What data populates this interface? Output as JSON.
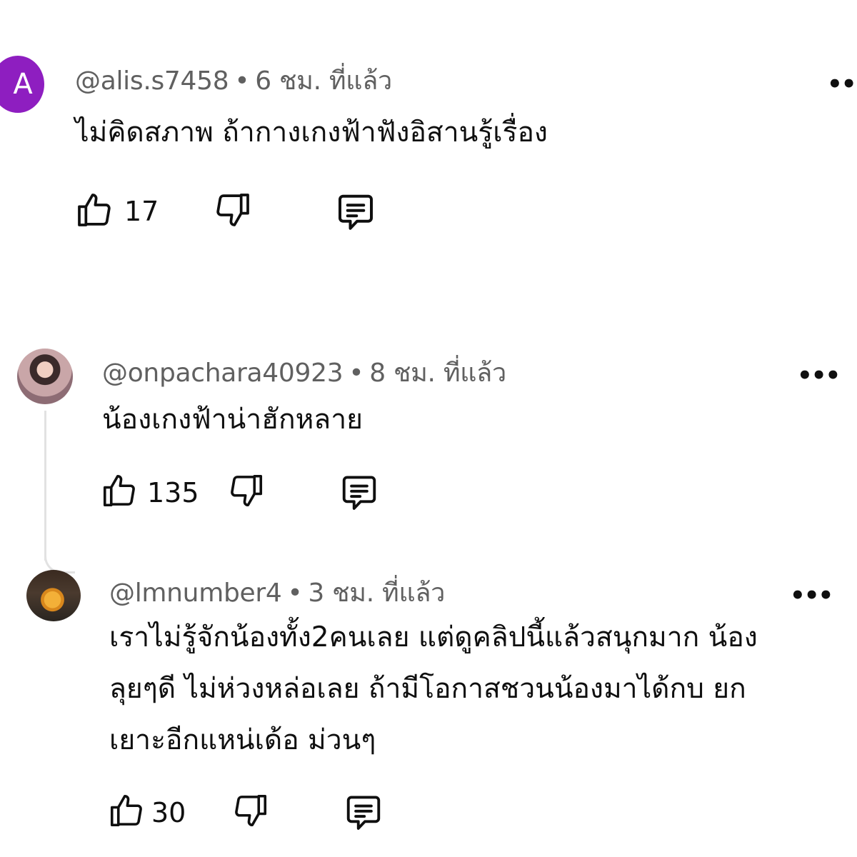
{
  "comments": [
    {
      "avatar_letter": "A",
      "avatar_color": "#8e1ec0",
      "handle": "@alis.s7458",
      "separator": "•",
      "time": "6 ชม. ที่แล้ว",
      "text": "ไม่คิดสภาพ ถ้ากางเกงฟ้าฟังอิสานรู้เรื่อง",
      "likes": "17",
      "more": "•••"
    },
    {
      "handle": "@onpachara40923",
      "separator": "•",
      "time": "8 ชม. ที่แล้ว",
      "text": "น้องเกงฟ้าน่าฮักหลาย",
      "likes": "135",
      "more": "•••"
    },
    {
      "handle": "@lmnumber4",
      "separator": "•",
      "time": "3 ชม. ที่แล้ว",
      "text": "เราไม่รู้จักน้องทั้ง2คนเลย แต่ดูคลิปนี้แล้วสนุกมาก น้อง\nลุยๆดี ไม่ห่วงหล่อเลย ถ้ามีโอกาสชวนน้องมาได้กบ ยก\nเยาะอีกแหน่เด้อ ม่วนๆ",
      "likes": "30",
      "more": "•••"
    }
  ],
  "icons": {
    "like": "thumbs-up-icon",
    "dislike": "thumbs-down-icon",
    "reply": "reply-icon",
    "more": "more-options-icon"
  }
}
